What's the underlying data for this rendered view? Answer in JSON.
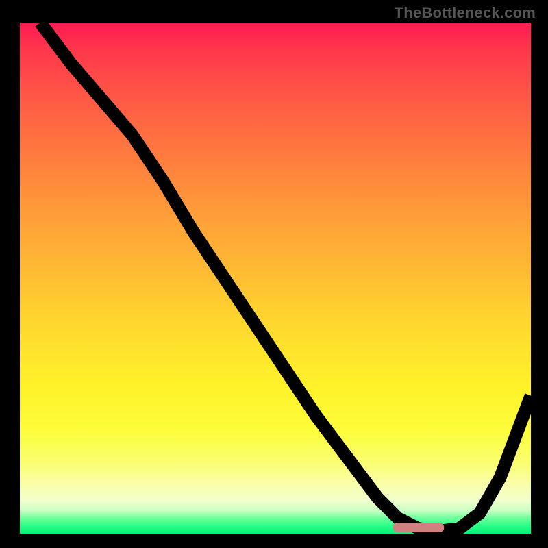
{
  "watermark": "TheBottleneck.com",
  "colors": {
    "frame": "#000000",
    "curve": "#000000",
    "marker": "#d08080"
  },
  "chart_data": {
    "type": "line",
    "title": "",
    "xlabel": "",
    "ylabel": "",
    "xlim": [
      0,
      100
    ],
    "ylim": [
      0,
      100
    ],
    "series": [
      {
        "name": "bottleneck-curve",
        "x": [
          4,
          10,
          16,
          22,
          28,
          34,
          40,
          46,
          52,
          58,
          64,
          70,
          74,
          78,
          82,
          86,
          90,
          94,
          100
        ],
        "y": [
          100,
          92,
          85,
          78,
          69,
          59,
          50,
          41,
          32,
          23,
          15,
          7,
          3,
          1,
          0.5,
          1,
          4,
          11,
          27
        ]
      }
    ],
    "annotations": [
      {
        "name": "target-marker",
        "shape": "rounded-bar",
        "x_range": [
          73,
          83
        ],
        "y": 1.2
      }
    ],
    "background": "red-to-green vertical gradient (bottleneck heat scale)"
  }
}
